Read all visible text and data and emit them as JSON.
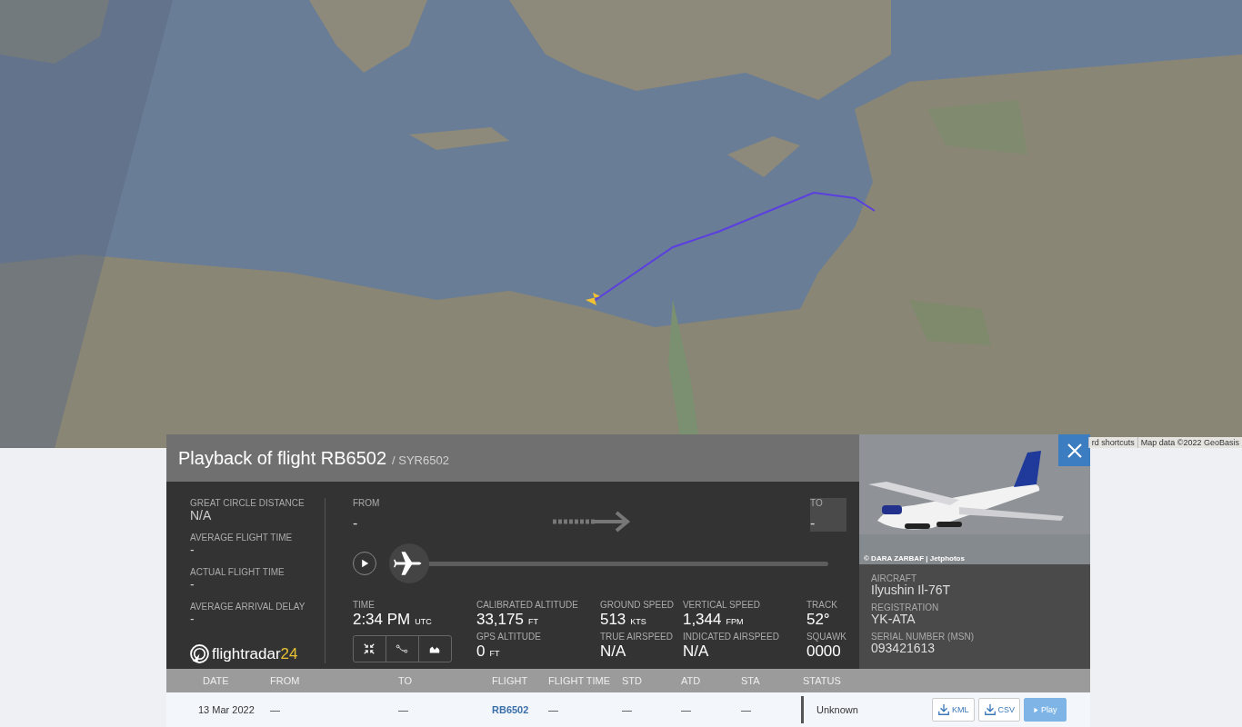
{
  "map": {
    "kind": "picture",
    "attribution": [
      "rd shortcuts",
      "Map data ©2022 GeoBasis"
    ]
  },
  "panel": {
    "title": "Playback of flight RB6502",
    "subtitle": "/ SYR6502",
    "summary": [
      {
        "label": "GREAT CIRCLE DISTANCE",
        "value": "N/A"
      },
      {
        "label": "AVERAGE FLIGHT TIME",
        "value": "-"
      },
      {
        "label": "ACTUAL FLIGHT TIME",
        "value": "-"
      },
      {
        "label": "AVERAGE ARRIVAL DELAY",
        "value": "-"
      }
    ],
    "logo": {
      "text": "flightradar",
      "accent": "24"
    },
    "route": {
      "from_label": "FROM",
      "from": "-",
      "to_label": "TO",
      "to": "-"
    },
    "playback": {
      "playing": false,
      "level": 0
    },
    "stats": [
      {
        "label": "TIME",
        "value": "2:34 PM",
        "unit": "UTC"
      },
      {
        "label": "CALIBRATED ALTITUDE",
        "value": "33,175",
        "unit": "FT"
      },
      {
        "label": "GROUND SPEED",
        "value": "513",
        "unit": "KTS"
      },
      {
        "label": "VERTICAL SPEED",
        "value": "1,344",
        "unit": "FPM"
      },
      {
        "label": "TRACK",
        "value": "52°"
      },
      {
        "label": "GPS ALTITUDE",
        "value": "0",
        "unit": "FT"
      },
      {
        "label": "TRUE AIRSPEED",
        "value": "N/A"
      },
      {
        "label": "INDICATED AIRSPEED",
        "value": "N/A"
      },
      {
        "label": "SQUAWK",
        "value": "0000"
      }
    ],
    "photo": {
      "kind": "picture",
      "credit": "© DARA ZARBAF | Jetphotos"
    },
    "aircraft": [
      {
        "label": "AIRCRAFT",
        "value": "Ilyushin Il-76T"
      },
      {
        "label": "REGISTRATION",
        "value": "YK-ATA"
      },
      {
        "label": "SERIAL NUMBER (MSN)",
        "value": "093421613"
      }
    ]
  },
  "table": {
    "columns": [
      "DATE",
      "FROM",
      "TO",
      "FLIGHT",
      "FLIGHT TIME",
      "STD",
      "ATD",
      "STA",
      "STATUS"
    ],
    "rows": [
      {
        "cells": [
          {
            "text": "13 Mar 2022"
          },
          {
            "text": "—"
          },
          {
            "text": "—"
          },
          {
            "text": "RB6502",
            "kind": "link"
          },
          {
            "text": "—"
          },
          {
            "text": "—"
          },
          {
            "text": "—"
          },
          {
            "text": "—"
          },
          {
            "text": "Unknown",
            "kind": "status"
          }
        ],
        "actions": [
          {
            "label": "KML",
            "kind": "download"
          },
          {
            "label": "CSV",
            "kind": "download"
          },
          {
            "label": "Play",
            "kind": "play"
          }
        ]
      }
    ]
  }
}
